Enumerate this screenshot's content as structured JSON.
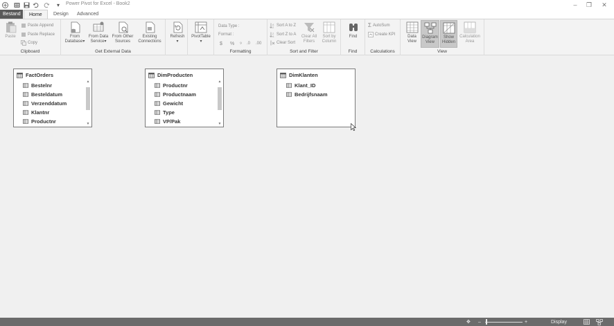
{
  "window": {
    "title": "Power Pivot for Excel - Book2",
    "minimize_glyph": "–",
    "restore_glyph": "❐",
    "close_glyph": "✕"
  },
  "quick_access": {
    "excel_icon": "excel-icon",
    "grid_icon": "grid-icon",
    "save_icon": "save-icon",
    "undo_icon": "undo-icon",
    "redo_icon": "redo-icon",
    "customize_glyph": "▾"
  },
  "tabs": {
    "file": "Bestand",
    "home": "Home",
    "design": "Design",
    "advanced": "Advanced"
  },
  "ribbon": {
    "clipboard": {
      "label": "Clipboard",
      "paste": "Paste",
      "paste_append": "Paste Append",
      "paste_replace": "Paste Replace",
      "copy": "Copy"
    },
    "external": {
      "label": "Get External Data",
      "from_database_1": "From",
      "from_database_2": "Database",
      "from_data_service_1": "From Data",
      "from_data_service_2": "Service",
      "from_other_1": "From Other",
      "from_other_2": "Sources",
      "existing_1": "Existing",
      "existing_2": "Connections",
      "dropdown_glyph": "▾"
    },
    "refresh": {
      "label": "Refresh"
    },
    "pivot": {
      "label": "PivotTable"
    },
    "formatting": {
      "label": "Formatting",
      "data_type": "Data Type :",
      "format": "Format :",
      "currency": "$",
      "percent": "%",
      "comma": "⁹",
      "inc_dec": ".0",
      "dec_dec": ".00"
    },
    "sort": {
      "label": "Sort and Filter",
      "sort_az": "Sort A to Z",
      "sort_za": "Sort Z to A",
      "clear_sort": "Clear Sort",
      "clear_filters_1": "Clear All",
      "clear_filters_2": "Filters",
      "sort_by_col_1": "Sort by",
      "sort_by_col_2": "Column"
    },
    "find": {
      "label": "Find",
      "button": "Find"
    },
    "calculations": {
      "label": "Calculations",
      "autosum": "AutoSum",
      "create_kpi": "Create KPI"
    },
    "view": {
      "label": "View",
      "data_view_1": "Data",
      "data_view_2": "View",
      "diagram_view_1": "Diagram",
      "diagram_view_2": "View",
      "show_hidden_1": "Show",
      "show_hidden_2": "Hidden",
      "calc_area_1": "Calculation",
      "calc_area_2": "Area"
    }
  },
  "tables": [
    {
      "name": "FactOrders",
      "fields": [
        "Bestelnr",
        "Besteldatum",
        "Verzenddatum",
        "Klantnr",
        "Productnr"
      ]
    },
    {
      "name": "DimProducten",
      "fields": [
        "Productnr",
        "Productnaam",
        "Gewicht",
        "Type",
        "VP/Pak"
      ]
    },
    {
      "name": "DimKlanten",
      "fields": [
        "Klant_ID",
        "Bedrijfsnaam"
      ]
    }
  ],
  "scroll": {
    "up": "▲",
    "down": "▼"
  },
  "statusbar": {
    "display": "Display",
    "zoom_minus": "–",
    "zoom_plus": "+",
    "fit_glyph": "✥"
  }
}
